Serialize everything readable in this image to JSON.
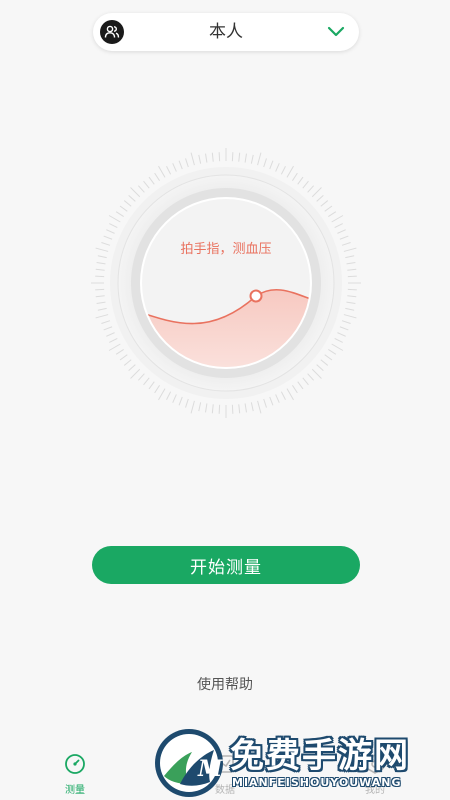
{
  "header": {
    "profile_name": "本人",
    "avatar_icon": "user-group-icon",
    "dropdown_icon": "chevron-down-icon",
    "accent_color": "#1aa863"
  },
  "gauge": {
    "instruction": "拍手指，测血压",
    "wave_color": "#e9725f"
  },
  "actions": {
    "start_label": "开始测量",
    "help_label": "使用帮助"
  },
  "tabbar": {
    "tabs": [
      {
        "label": "测量",
        "icon": "gauge-icon",
        "active": true
      },
      {
        "label": "数据",
        "icon": "chart-icon",
        "active": false
      },
      {
        "label": "我的",
        "icon": "profile-icon",
        "active": false
      }
    ]
  },
  "watermark": {
    "title": "免费手游网",
    "subtitle": "MIANFEISHOUYOUWANG",
    "logo_letter": "M"
  }
}
